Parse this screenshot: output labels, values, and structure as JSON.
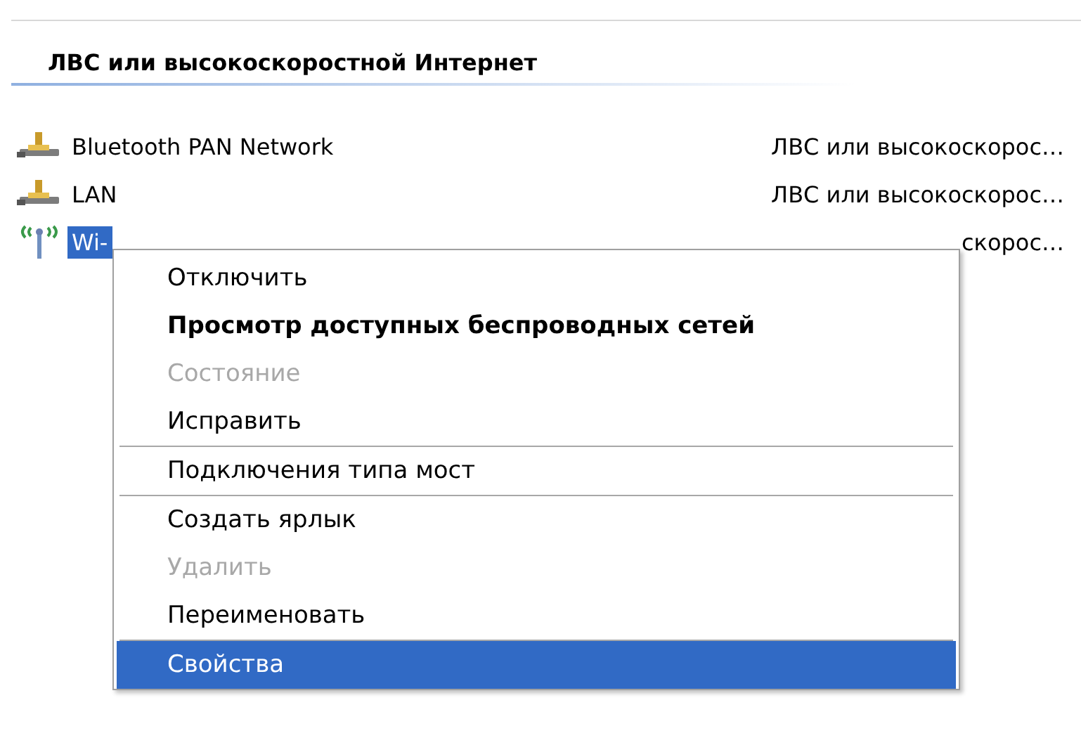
{
  "group": {
    "title": "ЛВС или высокоскоростной Интернет"
  },
  "connections": [
    {
      "kind": "wired",
      "name": "Bluetooth PAN Network",
      "type": "ЛВС или высокоскорос…",
      "selected": false
    },
    {
      "kind": "wired",
      "name": "LAN",
      "type": "ЛВС или высокоскорос…",
      "selected": false
    },
    {
      "kind": "wireless",
      "name": "Wi-",
      "type": "скорос…",
      "selected": true
    }
  ],
  "context_menu": [
    {
      "kind": "item",
      "label": "Отключить",
      "default": false,
      "disabled": false,
      "selected": false
    },
    {
      "kind": "item",
      "label": "Просмотр доступных беспроводных сетей",
      "default": true,
      "disabled": false,
      "selected": false
    },
    {
      "kind": "item",
      "label": "Состояние",
      "default": false,
      "disabled": true,
      "selected": false
    },
    {
      "kind": "item",
      "label": "Исправить",
      "default": false,
      "disabled": false,
      "selected": false
    },
    {
      "kind": "separator"
    },
    {
      "kind": "item",
      "label": "Подключения типа мост",
      "default": false,
      "disabled": false,
      "selected": false
    },
    {
      "kind": "separator"
    },
    {
      "kind": "item",
      "label": "Создать ярлык",
      "default": false,
      "disabled": false,
      "selected": false
    },
    {
      "kind": "item",
      "label": "Удалить",
      "default": false,
      "disabled": true,
      "selected": false
    },
    {
      "kind": "item",
      "label": "Переименовать",
      "default": false,
      "disabled": false,
      "selected": false
    },
    {
      "kind": "separator"
    },
    {
      "kind": "item",
      "label": "Свойства",
      "default": false,
      "disabled": false,
      "selected": true
    }
  ]
}
